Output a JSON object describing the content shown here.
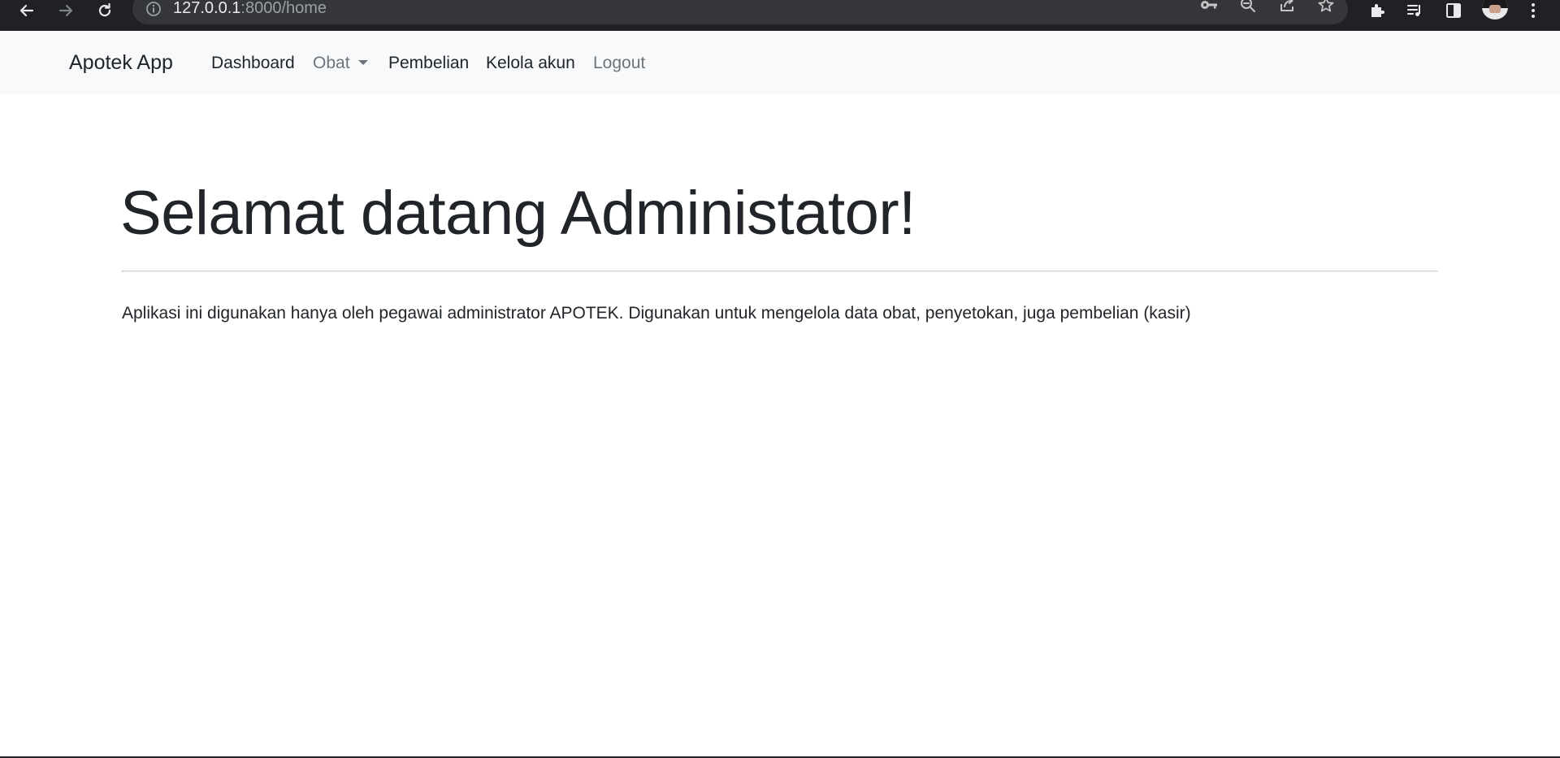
{
  "browser": {
    "url_host": "127.0.0.1",
    "url_rest": ":8000/home",
    "icons": [
      "back-arrow-icon",
      "forward-arrow-icon",
      "reload-icon",
      "info-icon",
      "key-icon",
      "zoom-out-icon",
      "share-icon",
      "star-icon",
      "extensions-icon",
      "media-queue-icon",
      "side-panel-icon",
      "avatar",
      "kebab-menu-icon"
    ]
  },
  "navbar": {
    "brand": "Apotek App",
    "items": [
      {
        "label": "Dashboard"
      },
      {
        "label": "Obat",
        "dropdown": true
      },
      {
        "label": "Pembelian"
      },
      {
        "label": "Kelola akun"
      },
      {
        "label": "Logout"
      }
    ]
  },
  "main": {
    "title": "Selamat datang Administator!",
    "description": "Aplikasi ini digunakan hanya oleh pegawai administrator APOTEK. Digunakan untuk mengelola data obat, penyetokan, juga pembelian (kasir)"
  },
  "colors": {
    "chrome_bg": "#202124",
    "omnibox_bg": "#35363a",
    "navbar_bg": "#f8f9fa",
    "text": "#212529",
    "muted_text": "#6c757d"
  }
}
